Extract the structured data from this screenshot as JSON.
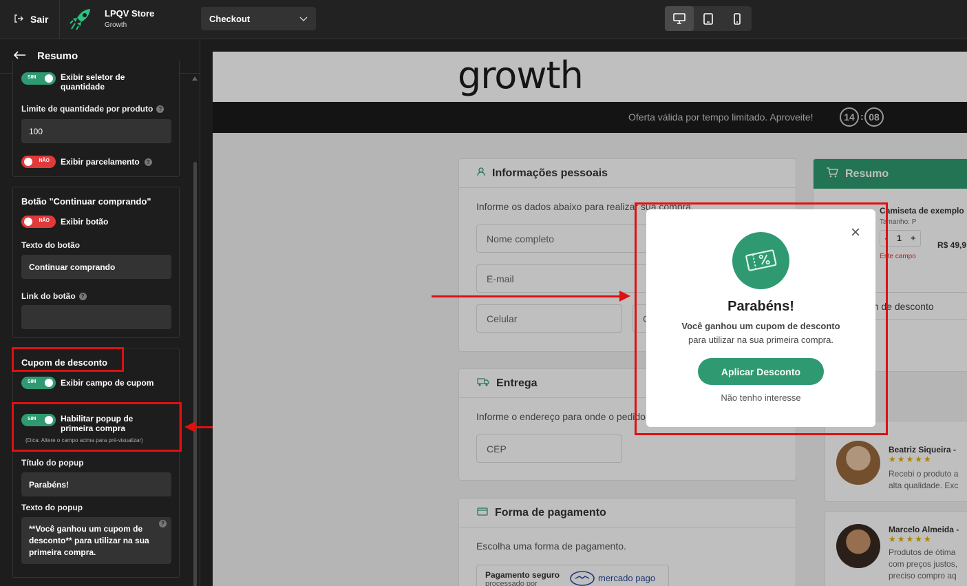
{
  "topbar": {
    "exit_label": "Sair",
    "store_name": "LPQV Store",
    "store_plan": "Growth",
    "page_select_value": "Checkout"
  },
  "sidebar": {
    "header_title": "Resumo",
    "section1": {
      "qty_selector_toggle": "SIM",
      "qty_selector_label": "Exibir seletor de quantidade",
      "qty_limit_label": "Limite de quantidade por produto",
      "qty_limit_value": "100",
      "installments_toggle": "NÃO",
      "installments_label": "Exibir parcelamento"
    },
    "continue_section": {
      "title": "Botão \"Continuar comprando\"",
      "show_button_toggle": "NÃO",
      "show_button_label": "Exibir botão",
      "button_text_label": "Texto do botão",
      "button_text_value": "Continuar comprando",
      "button_link_label": "Link do botão",
      "button_link_value": ""
    },
    "coupon_section": {
      "title": "Cupom de desconto",
      "show_field_toggle": "SIM",
      "show_field_label": "Exibir campo de cupom",
      "popup_toggle": "SIM",
      "popup_label": "Habilitar popup de primeira compra",
      "popup_hint": "(Dica: Altere o campo acima para pré-visualizar)",
      "popup_title_label": "Título do popup",
      "popup_title_value": "Parabéns!",
      "popup_text_label": "Texto do popup",
      "popup_text_value": "**Você ganhou um cupom de desconto** para utilizar na sua primeira compra."
    }
  },
  "preview": {
    "logo_text": "growth",
    "banner_text": "Oferta válida por tempo limitado. Aproveite!",
    "timer_min": "14",
    "timer_sep": ":",
    "timer_sec": "08",
    "personal": {
      "title": "Informações pessoais",
      "desc": "Informe os dados abaixo para realizar sua compra.",
      "name_placeholder": "Nome completo",
      "email_placeholder": "E-mail",
      "phone_placeholder": "Celular",
      "cpf_partial": "C"
    },
    "delivery": {
      "title": "Entrega",
      "desc": "Informe o endereço para onde o pedido será enviado.",
      "cep_placeholder": "CEP"
    },
    "payment": {
      "title": "Forma de pagamento",
      "desc": "Escolha uma forma de pagamento.",
      "secure_label": "Pagamento seguro",
      "secure_sub": "processado por",
      "provider": "mercado pago"
    },
    "summary": {
      "title": "Resumo",
      "product_name": "Camiseta de exemplo",
      "product_variant": "Tamanho: P",
      "qty_minus": "-",
      "qty_value": "1",
      "qty_plus": "+",
      "price": "R$ 49,9",
      "field_error": "Este campo",
      "coupon_placeholder": "Cupom de desconto"
    },
    "reviews": [
      {
        "name": "Beatriz Siqueira -",
        "stars": "★★★★★",
        "text1": "Recebi o produto a",
        "text2": "alta qualidade. Exc"
      },
      {
        "name": "Marcelo Almeida -",
        "stars": "★★★★★",
        "text1": "Produtos de ótima",
        "text2": "com preços justos,",
        "text3": "preciso compro aq"
      }
    ]
  },
  "modal": {
    "title": "Parabéns!",
    "body_bold": "Você ganhou um cupom de desconto",
    "body_rest": "para utilizar na sua primeira compra.",
    "apply_button": "Aplicar Desconto",
    "decline_link": "Não tenho interesse",
    "close_symbol": "×"
  },
  "colors": {
    "accent": "#2f9a72",
    "toggle_off": "#e03a3a",
    "annotation_red": "#e01010"
  }
}
